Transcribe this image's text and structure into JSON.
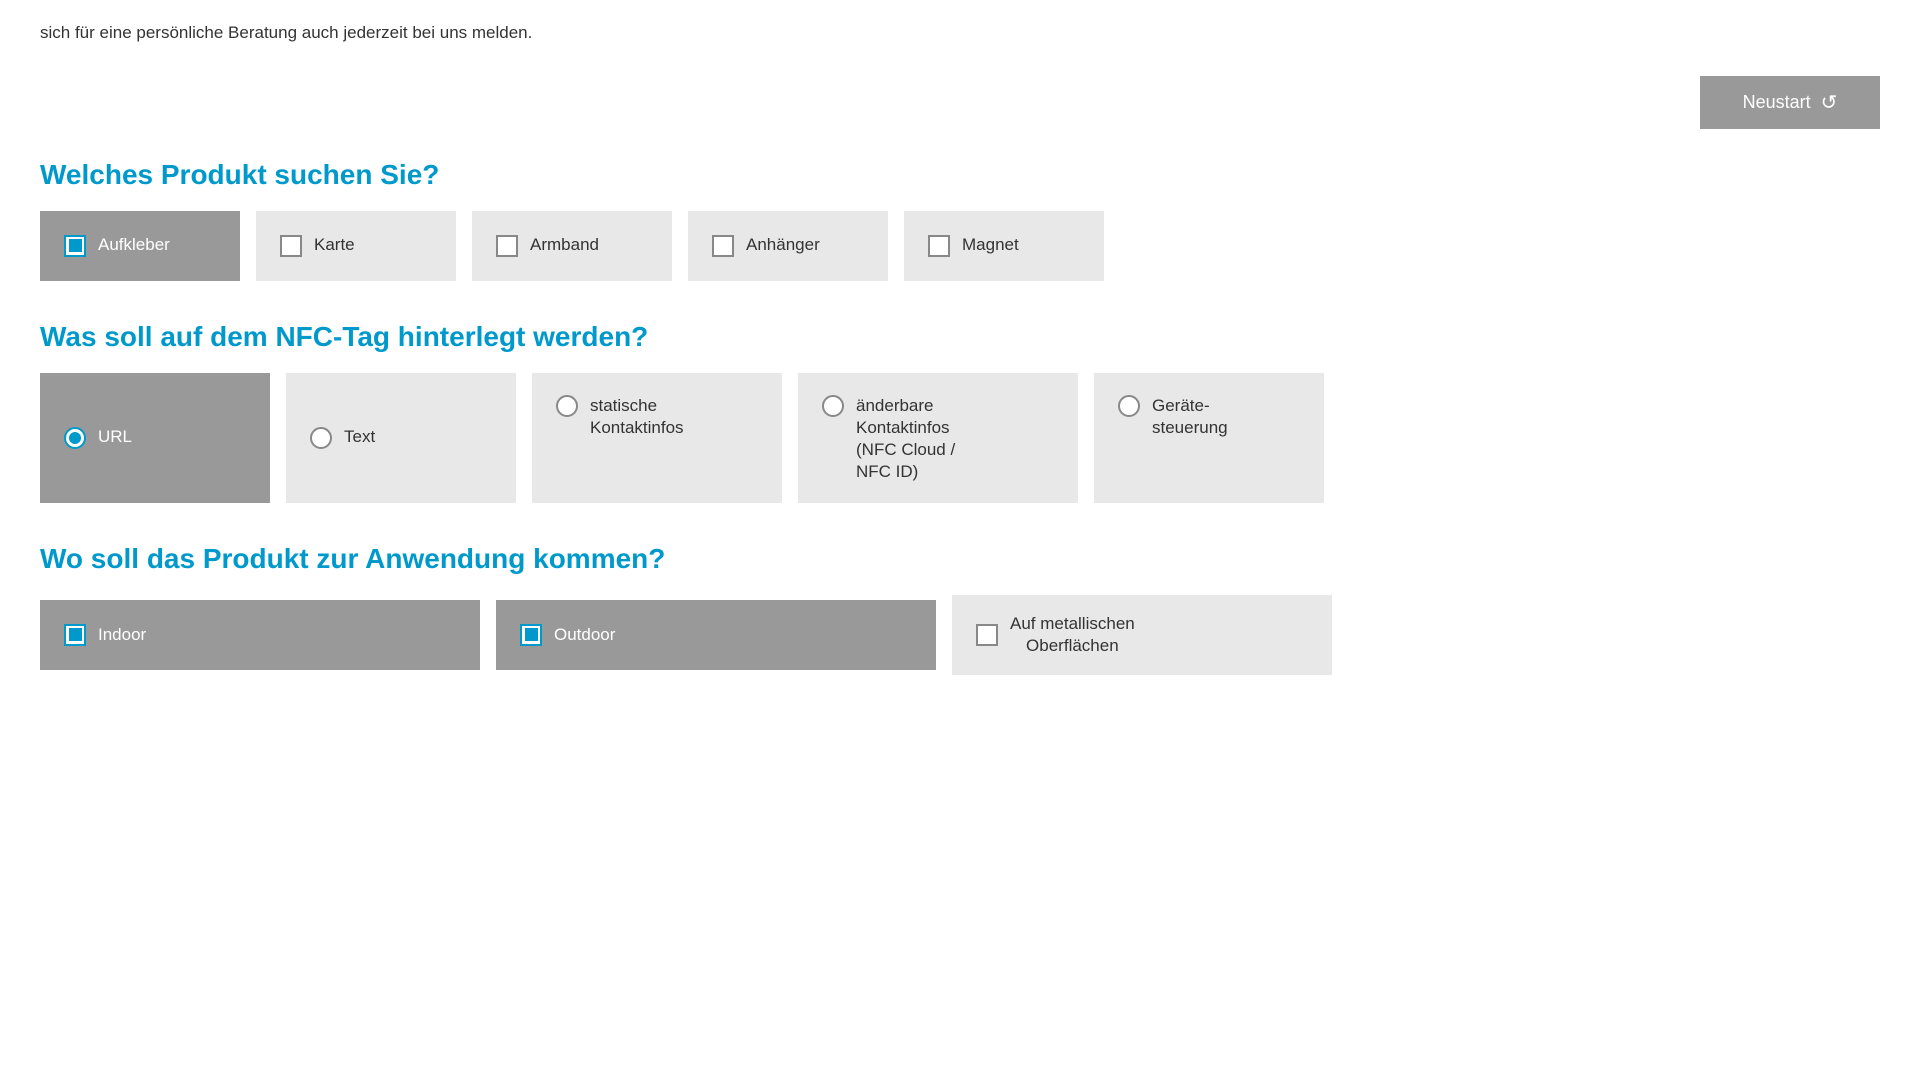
{
  "intro": {
    "text": "sich für eine persönliche Beratung auch jederzeit bei uns melden."
  },
  "neustart": {
    "label": "Neustart",
    "icon": "↺"
  },
  "product_section": {
    "title": "Welches Produkt suchen Sie?",
    "options": [
      {
        "id": "aufkleber",
        "label": "Aufkleber",
        "selected": true,
        "type": "checkbox"
      },
      {
        "id": "karte",
        "label": "Karte",
        "selected": false,
        "type": "checkbox"
      },
      {
        "id": "armband",
        "label": "Armband",
        "selected": false,
        "type": "checkbox"
      },
      {
        "id": "anhaenger",
        "label": "Anhänger",
        "selected": false,
        "type": "checkbox"
      },
      {
        "id": "magnet",
        "label": "Magnet",
        "selected": false,
        "type": "checkbox"
      }
    ]
  },
  "nfc_section": {
    "title": "Was soll auf dem NFC-Tag hinterlegt werden?",
    "options": [
      {
        "id": "url",
        "label": "URL",
        "selected": true,
        "type": "radio",
        "tall": false
      },
      {
        "id": "text",
        "label": "Text",
        "selected": false,
        "type": "radio",
        "tall": false
      },
      {
        "id": "statische",
        "label": "statische\nKontaktinfos",
        "selected": false,
        "type": "radio",
        "tall": true
      },
      {
        "id": "aenderbare",
        "label": "änderbare\nKontaktinfos\n(NFC Cloud /\nNFC ID)",
        "selected": false,
        "type": "radio",
        "tall": true
      },
      {
        "id": "geraete",
        "label": "Geräte-\nsteuerung",
        "selected": false,
        "type": "radio",
        "tall": true
      }
    ]
  },
  "location_section": {
    "title": "Wo soll das Produkt zur Anwendung kommen?",
    "options": [
      {
        "id": "indoor",
        "label": "Indoor",
        "selected": true,
        "type": "checkbox"
      },
      {
        "id": "outdoor",
        "label": "Outdoor",
        "selected": true,
        "type": "checkbox"
      },
      {
        "id": "metall",
        "label": "Auf metallischen\nOberflächen",
        "selected": false,
        "type": "checkbox"
      }
    ]
  }
}
